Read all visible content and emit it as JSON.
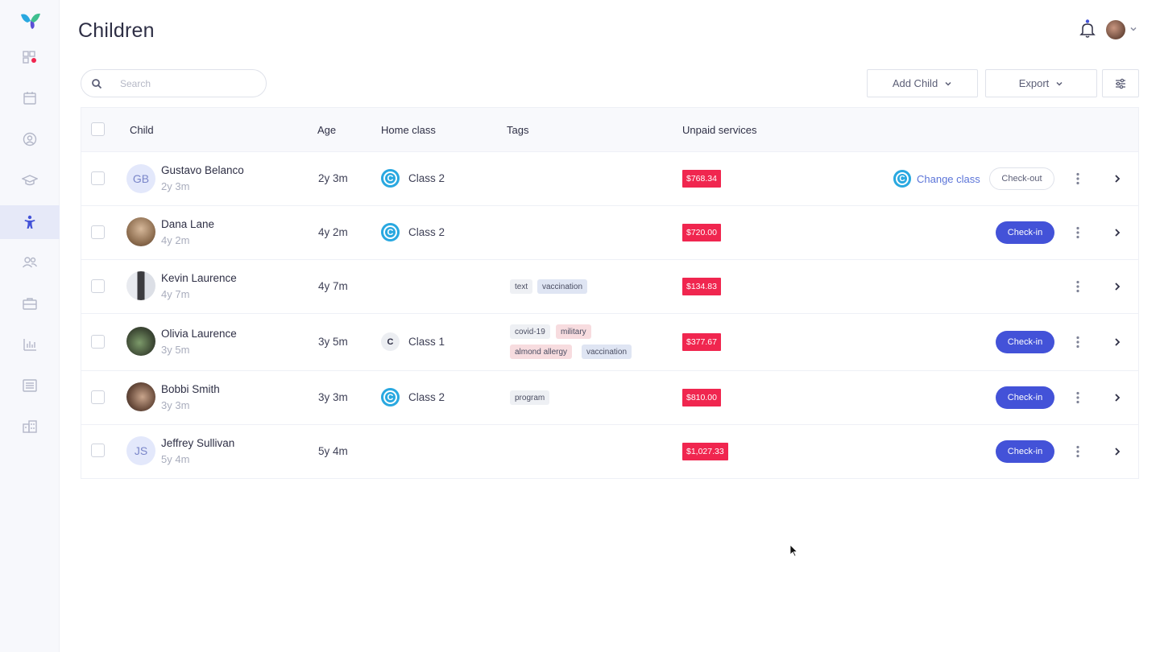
{
  "page": {
    "title": "Children"
  },
  "colors": {
    "accent": "#4352d8",
    "unpaid": "#f0264f",
    "class_blue": "#29a8e0",
    "link": "#5b74d8"
  },
  "sidebar": {
    "items": [
      {
        "icon": "dashboard-icon",
        "active": false
      },
      {
        "icon": "calendar-icon",
        "active": false
      },
      {
        "icon": "profile-icon",
        "active": false
      },
      {
        "icon": "graduation-cap-icon",
        "active": false
      },
      {
        "icon": "child-icon",
        "active": true
      },
      {
        "icon": "group-icon",
        "active": false
      },
      {
        "icon": "briefcase-icon",
        "active": false
      },
      {
        "icon": "bar-chart-icon",
        "active": false
      },
      {
        "icon": "list-icon",
        "active": false
      },
      {
        "icon": "building-icon",
        "active": false
      }
    ]
  },
  "search": {
    "placeholder": "Search",
    "value": ""
  },
  "toolbar": {
    "add_child": "Add Child",
    "export": "Export"
  },
  "table": {
    "headers": {
      "child": "Child",
      "age": "Age",
      "home_class": "Home class",
      "tags": "Tags",
      "unpaid": "Unpaid services"
    },
    "rows": [
      {
        "initials": "GB",
        "name": "Gustavo Belanco",
        "sub_age": "2y 3m",
        "age": "2y 3m",
        "class_letter": "C",
        "class_name": "Class 2",
        "unpaid": "$768.34",
        "change_class": "Change class",
        "action": "Check-out"
      },
      {
        "initials": "",
        "name": "Dana Lane",
        "sub_age": "4y 2m",
        "age": "4y 2m",
        "class_letter": "C",
        "class_name": "Class 2",
        "unpaid": "$720.00",
        "action": "Check-in"
      },
      {
        "initials": "",
        "name": "Kevin Laurence",
        "sub_age": "4y 7m",
        "age": "4y 7m",
        "tags": [
          "text",
          "vaccination"
        ],
        "unpaid": "$134.83"
      },
      {
        "initials": "",
        "name": "Olivia Laurence",
        "sub_age": "3y 5m",
        "age": "3y 5m",
        "class_letter": "C",
        "class_name": "Class 1",
        "tags": [
          "covid-19",
          "military",
          "almond allergy",
          "vaccination"
        ],
        "unpaid": "$377.67",
        "action": "Check-in"
      },
      {
        "initials": "",
        "name": "Bobbi Smith",
        "sub_age": "3y 3m",
        "age": "3y 3m",
        "class_letter": "C",
        "class_name": "Class 2",
        "tags": [
          "program"
        ],
        "unpaid": "$810.00",
        "action": "Check-in"
      },
      {
        "initials": "JS",
        "name": "Jeffrey Sullivan",
        "sub_age": "5y 4m",
        "age": "5y 4m",
        "unpaid": "$1,027.33",
        "action": "Check-in"
      }
    ]
  }
}
